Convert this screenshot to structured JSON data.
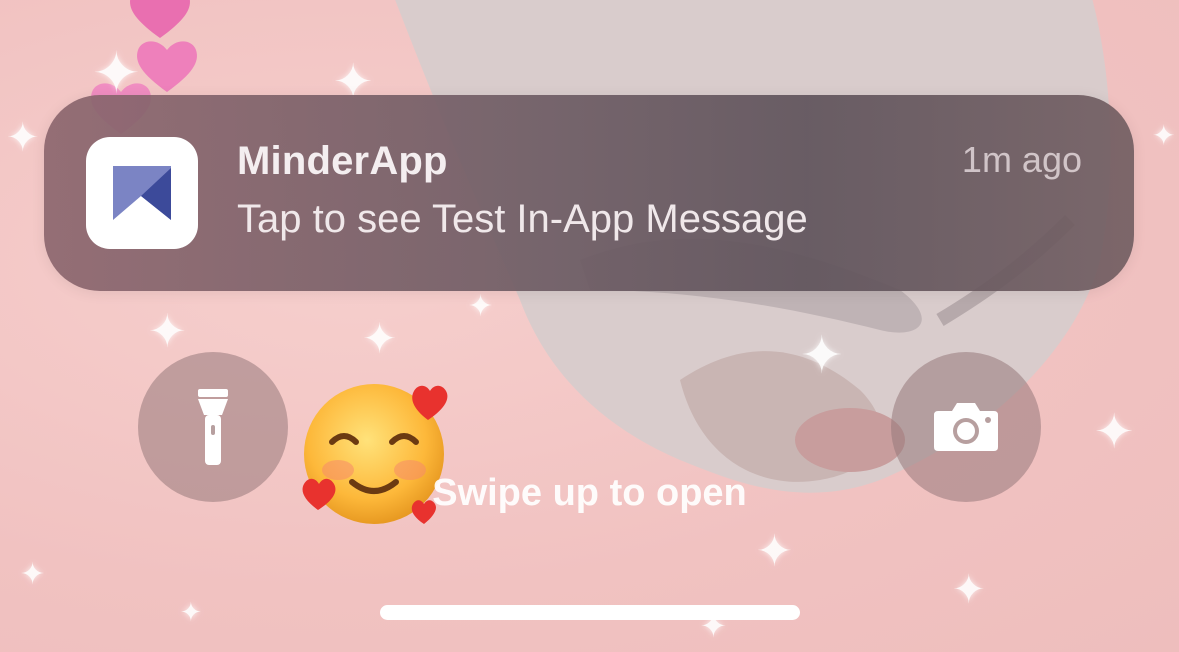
{
  "notification": {
    "app_name": "MinderApp",
    "time": "1m ago",
    "message": "Tap to see Test In-App Message",
    "app_icon": "minderapp-logo-icon"
  },
  "quick_actions": {
    "left_icon": "flashlight-icon",
    "right_icon": "camera-icon"
  },
  "swipe_hint": "Swipe up to open",
  "colors": {
    "wallpaper": "#f2c4c3",
    "notification_bg": "#6e5c64",
    "logo_light": "#7b84c4",
    "logo_dark": "#3c4a9a"
  }
}
